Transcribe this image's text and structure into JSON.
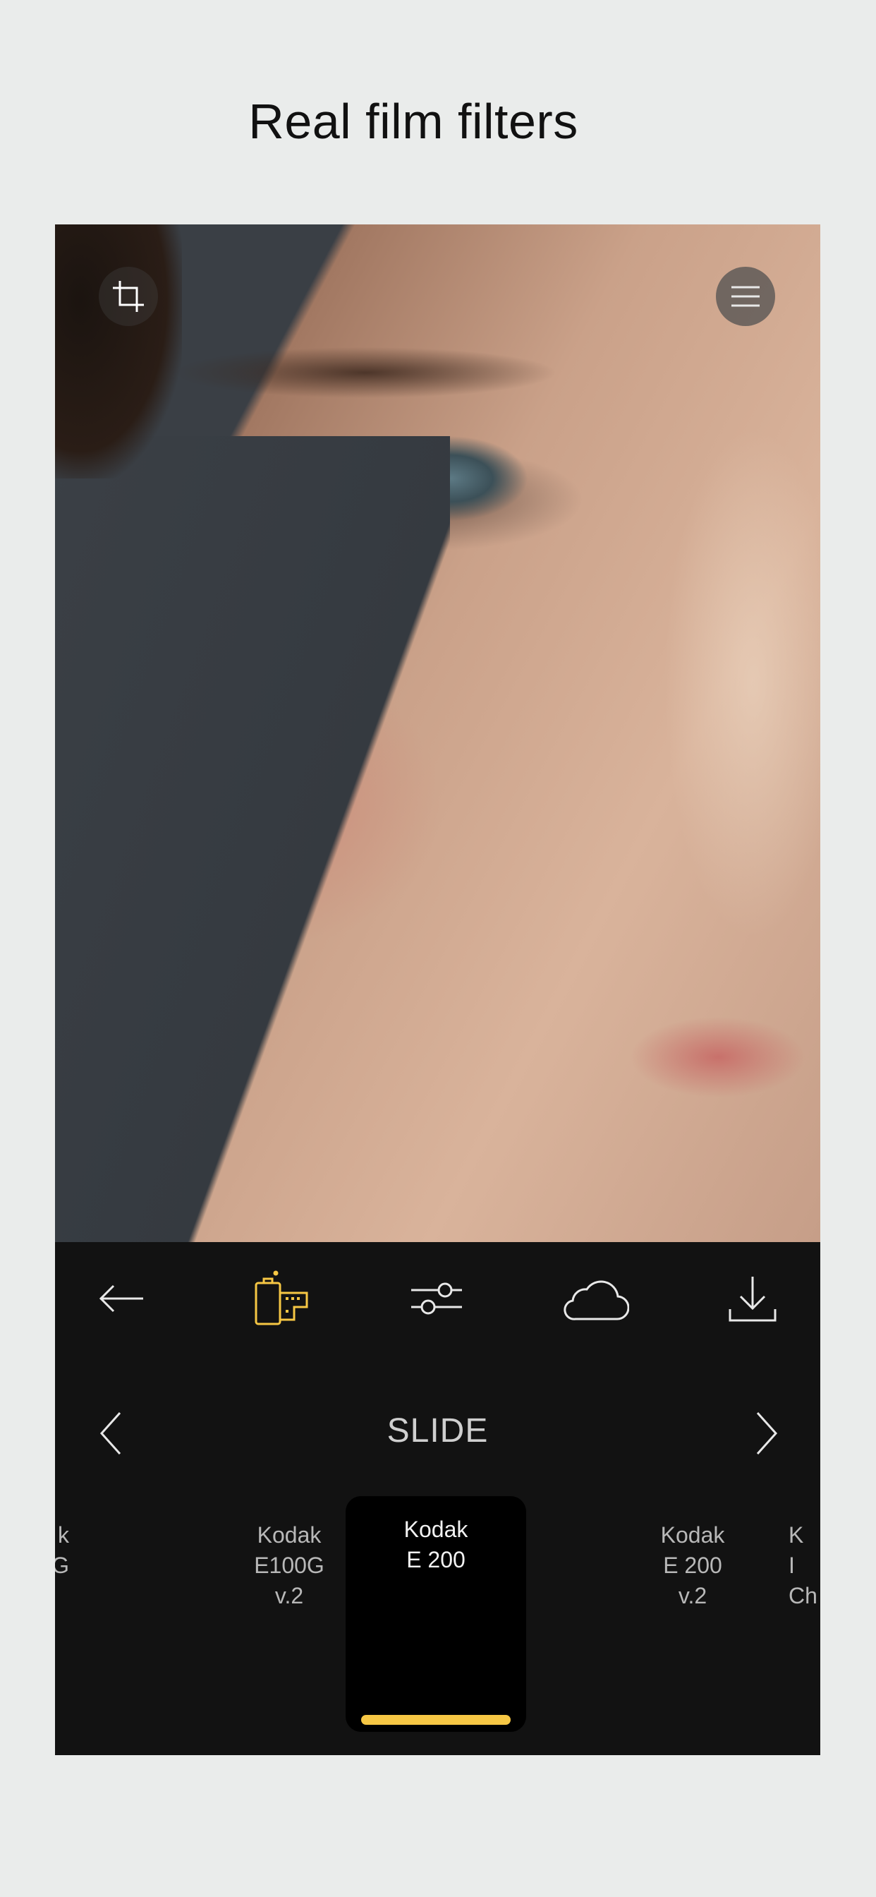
{
  "headline": "Real film filters",
  "colors": {
    "accent": "#f6c744",
    "panel": "#121212",
    "background": "#eaeceb"
  },
  "photo": {
    "description_icon": "portrait-photo"
  },
  "top_controls": {
    "crop_icon": "crop-icon",
    "menu_icon": "hamburger-menu-icon"
  },
  "toolbar": {
    "items": [
      {
        "name": "back",
        "icon": "arrow-left-icon"
      },
      {
        "name": "film",
        "icon": "film-canister-icon",
        "active": true
      },
      {
        "name": "adjust",
        "icon": "sliders-icon"
      },
      {
        "name": "cloud",
        "icon": "cloud-icon"
      },
      {
        "name": "download",
        "icon": "download-icon"
      }
    ]
  },
  "category": {
    "label": "SLIDE"
  },
  "presets": [
    {
      "line1": "k",
      "line2": "G",
      "line3": ""
    },
    {
      "line1": "Kodak",
      "line2": "E100G",
      "line3": "v.2"
    },
    {
      "line1": "Kodak",
      "line2": "E 200",
      "line3": "",
      "selected": true
    },
    {
      "line1": "Kodak",
      "line2": "E 200",
      "line3": "v.2"
    },
    {
      "line1": "K",
      "line2": "I",
      "line3": "Ch"
    }
  ]
}
